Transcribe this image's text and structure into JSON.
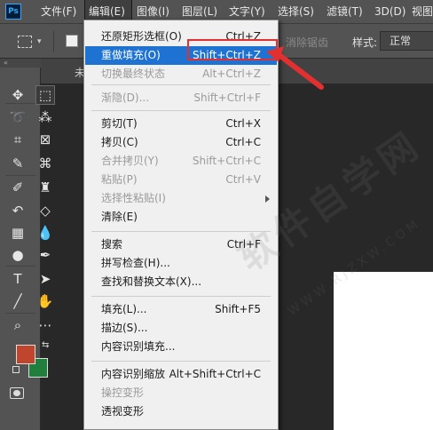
{
  "app": {
    "logo": "Ps"
  },
  "menubar": {
    "items": [
      {
        "label": "文件(F)"
      },
      {
        "label": "编辑(E)"
      },
      {
        "label": "图像(I)"
      },
      {
        "label": "图层(L)"
      },
      {
        "label": "文字(Y)"
      },
      {
        "label": "选择(S)"
      },
      {
        "label": "滤镜(T)"
      },
      {
        "label": "3D(D)"
      },
      {
        "label": "视图"
      }
    ]
  },
  "options": {
    "antialias_label": "消除锯齿",
    "style_label": "样式:",
    "style_value": "正常"
  },
  "document": {
    "tab_label": "未"
  },
  "toolbar": {
    "tools": [
      {
        "name": "move-tool",
        "glyph": "✥"
      },
      {
        "name": "marquee-tool",
        "glyph": "⬚"
      },
      {
        "name": "lasso-tool",
        "glyph": "➰"
      },
      {
        "name": "magic-wand-tool",
        "glyph": "⁂"
      },
      {
        "name": "crop-tool",
        "glyph": "⌗"
      },
      {
        "name": "frame-tool",
        "glyph": "⊠"
      },
      {
        "name": "eyedropper-tool",
        "glyph": "✎"
      },
      {
        "name": "spot-healing-tool",
        "glyph": "⌘"
      },
      {
        "name": "brush-tool",
        "glyph": "✐"
      },
      {
        "name": "stamp-tool",
        "glyph": "♜"
      },
      {
        "name": "history-brush-tool",
        "glyph": "↶"
      },
      {
        "name": "eraser-tool",
        "glyph": "◇"
      },
      {
        "name": "gradient-tool",
        "glyph": "▦"
      },
      {
        "name": "blur-tool",
        "glyph": "💧"
      },
      {
        "name": "dodge-tool",
        "glyph": "●"
      },
      {
        "name": "pen-tool",
        "glyph": "✒"
      },
      {
        "name": "type-tool",
        "glyph": "T"
      },
      {
        "name": "path-select-tool",
        "glyph": "➤"
      },
      {
        "name": "line-tool",
        "glyph": "╱"
      },
      {
        "name": "hand-tool",
        "glyph": "✋"
      },
      {
        "name": "zoom-tool",
        "glyph": "⌕"
      },
      {
        "name": "more-tools",
        "glyph": "⋯"
      }
    ],
    "foreground_color": "#c0452d",
    "background_color": "#217f3e"
  },
  "colors": {
    "highlight": "#1e72d2",
    "annotation_red": "#e23030"
  },
  "edit_menu": {
    "items": [
      {
        "label": "还原矩形选框(O)",
        "shortcut": "Ctrl+Z",
        "state": "enabled"
      },
      {
        "label": "重做填充(O)",
        "shortcut": "Shift+Ctrl+Z",
        "state": "highlighted"
      },
      {
        "label": "切换最终状态",
        "shortcut": "Alt+Ctrl+Z",
        "state": "disabled"
      },
      {
        "label": "渐隐(D)...",
        "shortcut": "Shift+Ctrl+F",
        "state": "disabled"
      },
      {
        "label": "剪切(T)",
        "shortcut": "Ctrl+X",
        "state": "enabled"
      },
      {
        "label": "拷贝(C)",
        "shortcut": "Ctrl+C",
        "state": "enabled"
      },
      {
        "label": "合并拷贝(Y)",
        "shortcut": "Shift+Ctrl+C",
        "state": "disabled"
      },
      {
        "label": "粘贴(P)",
        "shortcut": "Ctrl+V",
        "state": "disabled"
      },
      {
        "label": "选择性粘贴(I)",
        "shortcut": "",
        "state": "disabled"
      },
      {
        "label": "清除(E)",
        "shortcut": "",
        "state": "enabled"
      },
      {
        "label": "搜索",
        "shortcut": "Ctrl+F",
        "state": "enabled"
      },
      {
        "label": "拼写检查(H)...",
        "shortcut": "",
        "state": "enabled"
      },
      {
        "label": "查找和替换文本(X)...",
        "shortcut": "",
        "state": "enabled"
      },
      {
        "label": "填充(L)...",
        "shortcut": "Shift+F5",
        "state": "enabled"
      },
      {
        "label": "描边(S)...",
        "shortcut": "",
        "state": "enabled"
      },
      {
        "label": "内容识别填充...",
        "shortcut": "",
        "state": "enabled"
      },
      {
        "label": "内容识别缩放",
        "shortcut": "Alt+Shift+Ctrl+C",
        "state": "enabled"
      },
      {
        "label": "操控变形",
        "shortcut": "",
        "state": "disabled"
      },
      {
        "label": "透视变形",
        "shortcut": "",
        "state": "enabled"
      }
    ]
  },
  "watermark": {
    "text": "软件自学网",
    "subtext": "WWW.RJZXW.COM"
  }
}
